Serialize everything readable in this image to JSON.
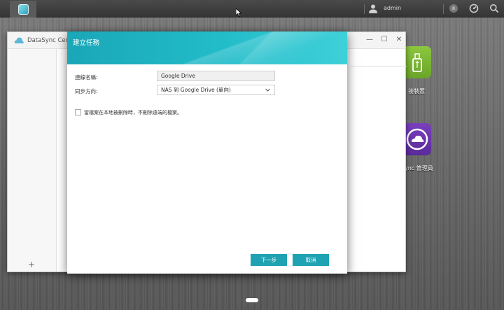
{
  "taskbar": {
    "user_name": "admin"
  },
  "desktop": {
    "usb_label": "接裝置",
    "datasync_label": "ync 管理員"
  },
  "background_window": {
    "title": "DataSync Cente",
    "add_label": "+"
  },
  "dialog": {
    "title": "建立任務",
    "connection_label": "連線名稱:",
    "connection_value": "Google Drive",
    "sync_direction_label": "同步方向:",
    "sync_direction_value": "NAS 到 Google Drive (單向)",
    "checkbox_label": "當檔案在本地被刪除時，不刪除遠端的檔案。",
    "next_button": "下一步",
    "cancel_button": "取消"
  },
  "colors": {
    "accent": "#1fa3b3",
    "header_teal": "#22bcc9",
    "usb_green": "#8dc63f",
    "datasync_purple": "#6a34ad"
  }
}
